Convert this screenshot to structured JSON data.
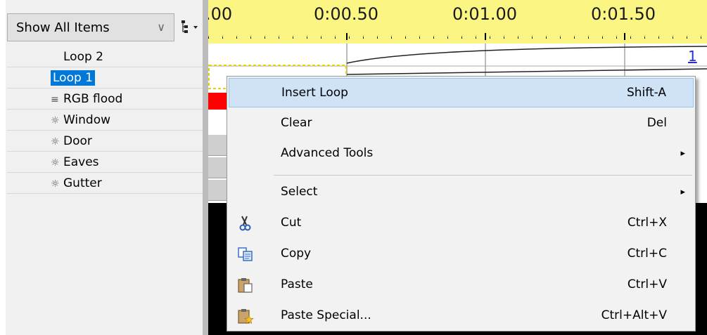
{
  "left_panel": {
    "filter_combo": {
      "value": "Show All Items",
      "chevron": "∨"
    },
    "tree_items": [
      {
        "glyph": "",
        "label": "Loop 2",
        "selected": false
      },
      {
        "glyph": "",
        "label": "Loop 1",
        "selected": true
      },
      {
        "glyph": "≡",
        "label": "RGB flood",
        "selected": false
      },
      {
        "glyph": "☼",
        "label": "Window",
        "selected": false
      },
      {
        "glyph": "☼",
        "label": "Door",
        "selected": false
      },
      {
        "glyph": "☼",
        "label": "Eaves",
        "selected": false
      },
      {
        "glyph": "☼",
        "label": "Gutter",
        "selected": false
      }
    ]
  },
  "timeline": {
    "ticks": [
      ".00",
      "0:00.50",
      "0:01.00",
      "0:01.50"
    ],
    "row_number": "1",
    "colors": {
      "ruler": "#fbf584",
      "red_block": "#ff0000",
      "selection_dash": "#e8d200"
    }
  },
  "context_menu": {
    "items": [
      {
        "label": "Insert Loop",
        "shortcut": "Shift-A",
        "icon": ""
      },
      {
        "label": "Clear",
        "shortcut": "Del",
        "icon": ""
      },
      {
        "label": "Advanced Tools",
        "shortcut": "",
        "icon": "",
        "submenu": "▸"
      },
      {
        "label": "Select",
        "shortcut": "",
        "icon": "",
        "submenu": "▸"
      },
      {
        "label": "Cut",
        "shortcut": "Ctrl+X",
        "icon": "scissors-icon"
      },
      {
        "label": "Copy",
        "shortcut": "Ctrl+C",
        "icon": "copy-icon"
      },
      {
        "label": "Paste",
        "shortcut": "Ctrl+V",
        "icon": "paste-icon"
      },
      {
        "label": "Paste Special...",
        "shortcut": "Ctrl+Alt+V",
        "icon": "paste-special-icon"
      }
    ]
  }
}
